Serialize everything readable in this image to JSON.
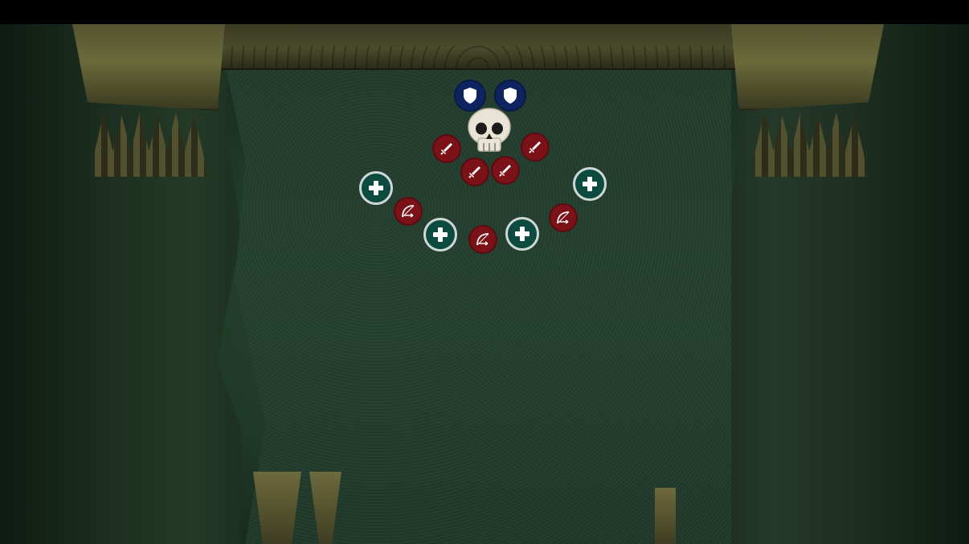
{
  "scene": {
    "description_type": "raid-positioning-map",
    "colors": {
      "tank": "#0e2460",
      "damage": "#7a1218",
      "healer": "#0d4a3f",
      "healer_ring": "#cfd8d6",
      "floor": "#24402f"
    }
  },
  "markers": {
    "boss": {
      "icon": "skull-icon"
    },
    "tanks": [
      {
        "icon": "shield-icon"
      },
      {
        "icon": "shield-icon"
      }
    ],
    "melee": [
      {
        "icon": "sword-icon"
      },
      {
        "icon": "sword-icon"
      },
      {
        "icon": "sword-icon"
      },
      {
        "icon": "sword-icon"
      }
    ],
    "ranged": [
      {
        "icon": "bow-icon"
      },
      {
        "icon": "bow-icon"
      },
      {
        "icon": "bow-icon"
      }
    ],
    "healers": [
      {
        "icon": "plus-icon"
      },
      {
        "icon": "plus-icon"
      },
      {
        "icon": "plus-icon"
      },
      {
        "icon": "plus-icon"
      }
    ]
  }
}
